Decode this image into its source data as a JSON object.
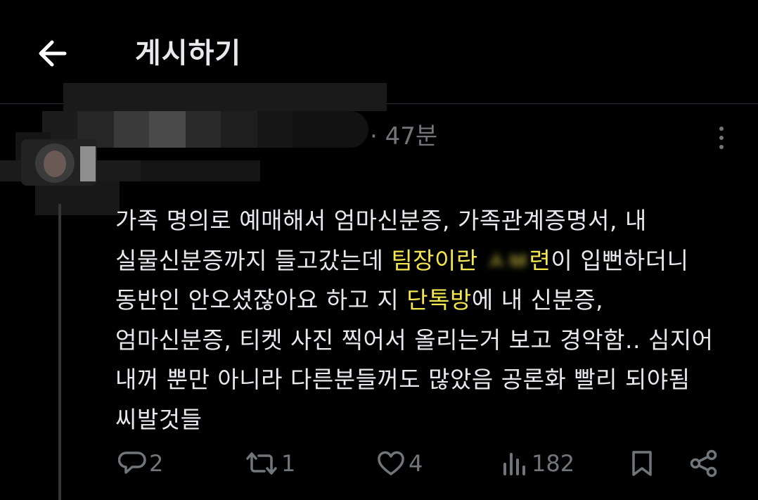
{
  "header": {
    "title": "게시하기"
  },
  "post": {
    "time": "· 47분",
    "lines": [
      [
        {
          "t": "가족 명의로 예매해서 엄마신분증, 가족관계증명서, 내",
          "h": false
        }
      ],
      [
        {
          "t": "실물신분증까지 들고갔는데 ",
          "h": false
        },
        {
          "t": "팀장이란 ",
          "h": true
        },
        {
          "t": "ㅅㅂ",
          "h": "blur"
        },
        {
          "t": "련",
          "h": true
        },
        {
          "t": "이 입뻔하더니",
          "h": false
        }
      ],
      [
        {
          "t": "동반인 안오셨잖아요 하고 지 ",
          "h": false
        },
        {
          "t": "단톡방",
          "h": true
        },
        {
          "t": "에 내 신분증,",
          "h": false
        }
      ],
      [
        {
          "t": "엄마신분증, 티켓 사진 찍어서 올리는거 보고 경악함.. 심지어",
          "h": false
        }
      ],
      [
        {
          "t": "내꺼 뿐만 아니라 다른분들꺼도 많았음 공론화 빨리 되야됨",
          "h": false
        }
      ],
      [
        {
          "t": "씨발것들",
          "h": false
        }
      ]
    ]
  },
  "actions": {
    "reply_count": "2",
    "repost_count": "1",
    "like_count": "4",
    "view_count": "182"
  },
  "icons": {
    "back": "arrow-left-icon",
    "more": "more-vertical-icon",
    "reply": "reply-icon",
    "repost": "repost-icon",
    "like": "heart-icon",
    "views": "views-icon",
    "bookmark": "bookmark-icon",
    "share": "share-icon"
  },
  "colors": {
    "background": "#000000",
    "text": "#e7e9ea",
    "muted": "#71767b",
    "highlight": "#f4e64f",
    "divider": "#2f3336"
  }
}
